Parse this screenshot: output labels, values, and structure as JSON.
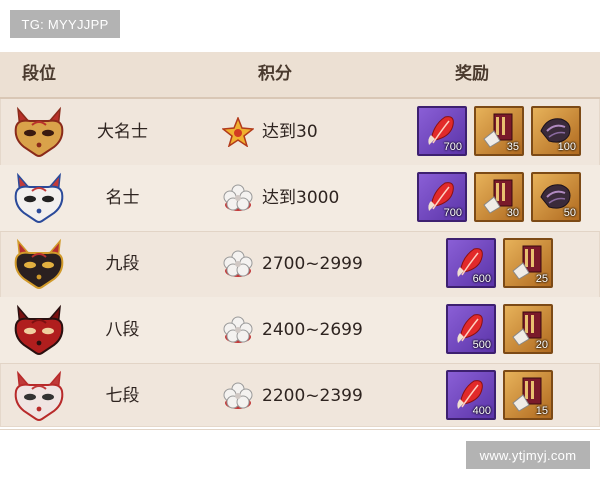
{
  "watermarks": {
    "top": "TG: MYYJJPP",
    "bottom": "www.ytjmyj.com"
  },
  "header": {
    "rank": "段位",
    "score": "积分",
    "reward": "奖励"
  },
  "colors": {
    "panel": "#f0e6dc",
    "purple_tile": "#6f46bf",
    "gold_tile": "#c98a35"
  },
  "rows": [
    {
      "rank": "大名士",
      "mask_icon": "gold-fox-mask-icon",
      "score_icon": "gold-star-icon",
      "score": "达到30",
      "rewards": [
        {
          "type": "purple",
          "icon": "red-feather-icon",
          "qty": "700"
        },
        {
          "type": "gold",
          "icon": "scroll-banner-icon",
          "qty": "35"
        },
        {
          "type": "gold",
          "icon": "dark-fabric-icon",
          "qty": "100"
        }
      ]
    },
    {
      "rank": "名士",
      "mask_icon": "white-fox-mask-icon",
      "score_icon": "white-flower-icon",
      "score": "达到3000",
      "rewards": [
        {
          "type": "purple",
          "icon": "red-feather-icon",
          "qty": "700"
        },
        {
          "type": "gold",
          "icon": "scroll-banner-icon",
          "qty": "30"
        },
        {
          "type": "gold",
          "icon": "dark-fabric-icon",
          "qty": "50"
        }
      ]
    },
    {
      "rank": "九段",
      "mask_icon": "black-fox-mask-icon",
      "score_icon": "white-flower-icon",
      "score": "2700~2999",
      "rewards": [
        {
          "type": "purple",
          "icon": "red-feather-icon",
          "qty": "600"
        },
        {
          "type": "gold",
          "icon": "scroll-banner-icon",
          "qty": "25"
        }
      ]
    },
    {
      "rank": "八段",
      "mask_icon": "red-fox-mask-icon",
      "score_icon": "white-flower-icon",
      "score": "2400~2699",
      "rewards": [
        {
          "type": "purple",
          "icon": "red-feather-icon",
          "qty": "500"
        },
        {
          "type": "gold",
          "icon": "scroll-banner-icon",
          "qty": "20"
        }
      ]
    },
    {
      "rank": "七段",
      "mask_icon": "pale-fox-mask-icon",
      "score_icon": "white-flower-icon",
      "score": "2200~2399",
      "rewards": [
        {
          "type": "purple",
          "icon": "red-feather-icon",
          "qty": "400"
        },
        {
          "type": "gold",
          "icon": "scroll-banner-icon",
          "qty": "15"
        }
      ]
    }
  ]
}
